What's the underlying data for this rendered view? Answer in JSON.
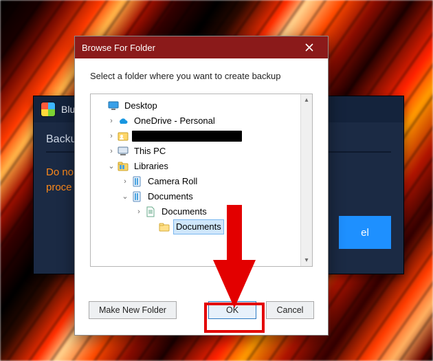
{
  "background_app": {
    "title": "Blu",
    "heading": "Backu",
    "warn_line1": "Do no",
    "warn_line2": "proce",
    "side_button": "el"
  },
  "dialog": {
    "title": "Browse For Folder",
    "instruction": "Select a folder where you want to create backup",
    "buttons": {
      "make_new_folder": "Make New Folder",
      "ok": "OK",
      "cancel": "Cancel"
    }
  },
  "tree": [
    {
      "id": "desktop",
      "level": 1,
      "expander": "",
      "icon": "desktop",
      "label": "Desktop",
      "selected": false,
      "redacted": false
    },
    {
      "id": "onedrive",
      "level": 2,
      "expander": ">",
      "icon": "onedrive",
      "label": "OneDrive - Personal",
      "selected": false,
      "redacted": false
    },
    {
      "id": "user",
      "level": 2,
      "expander": ">",
      "icon": "user",
      "label": "",
      "selected": false,
      "redacted": true,
      "redact_width": 160
    },
    {
      "id": "thispc",
      "level": 2,
      "expander": ">",
      "icon": "pc",
      "label": "This PC",
      "selected": false,
      "redacted": false
    },
    {
      "id": "libraries",
      "level": 2,
      "expander": "v",
      "icon": "lib",
      "label": "Libraries",
      "selected": false,
      "redacted": false
    },
    {
      "id": "camroll",
      "level": 3,
      "expander": ">",
      "icon": "liblib",
      "label": "Camera Roll",
      "selected": false,
      "redacted": false
    },
    {
      "id": "docslib",
      "level": 3,
      "expander": "v",
      "icon": "liblib",
      "label": "Documents",
      "selected": false,
      "redacted": false
    },
    {
      "id": "docsloc",
      "level": 4,
      "expander": ">",
      "icon": "doc",
      "label": "Documents",
      "selected": false,
      "redacted": false
    },
    {
      "id": "docssel",
      "level": 5,
      "expander": "",
      "icon": "folder",
      "label": "Documents",
      "selected": true,
      "redacted": false
    }
  ],
  "annotation": {
    "target": "ok"
  },
  "colors": {
    "accent_red": "#e30000",
    "titlebar": "#8b1a1a",
    "panel": "#1b2a44",
    "warn": "#ff8a1a",
    "select": "#cfe6fb"
  }
}
